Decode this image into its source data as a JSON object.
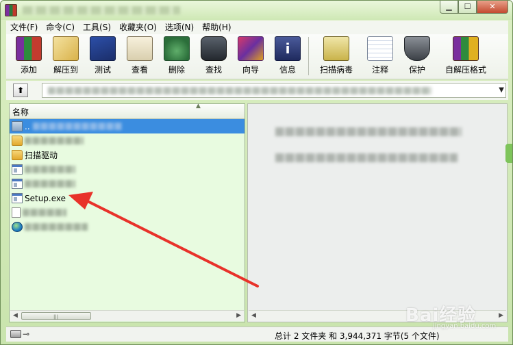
{
  "menubar": {
    "items": [
      "文件(F)",
      "命令(C)",
      "工具(S)",
      "收藏夹(O)",
      "选项(N)",
      "帮助(H)"
    ]
  },
  "toolbar": {
    "buttons": [
      {
        "label": "添加",
        "icon": "add-archive-icon"
      },
      {
        "label": "解压到",
        "icon": "extract-to-icon"
      },
      {
        "label": "测试",
        "icon": "test-icon"
      },
      {
        "label": "查看",
        "icon": "view-icon"
      },
      {
        "label": "删除",
        "icon": "delete-icon"
      },
      {
        "label": "查找",
        "icon": "find-icon"
      },
      {
        "label": "向导",
        "icon": "wizard-icon"
      },
      {
        "label": "信息",
        "icon": "info-icon"
      },
      {
        "label": "扫描病毒",
        "icon": "virus-scan-icon"
      },
      {
        "label": "注释",
        "icon": "comment-icon"
      },
      {
        "label": "保护",
        "icon": "protect-icon"
      },
      {
        "label": "自解压格式",
        "icon": "sfx-icon"
      }
    ]
  },
  "addressbar": {
    "up_label": "⬆"
  },
  "filelist": {
    "column_name": "名称",
    "items": [
      {
        "name": "..",
        "type": "folder-up",
        "selected": true
      },
      {
        "name": "",
        "type": "folder",
        "blurred": true
      },
      {
        "name": "扫描驱动",
        "type": "folder"
      },
      {
        "name": "",
        "type": "exe",
        "blurred": true
      },
      {
        "name": "",
        "type": "exe",
        "blurred": true
      },
      {
        "name": "Setup.exe",
        "type": "exe"
      },
      {
        "name": "",
        "type": "doc",
        "blurred": true
      },
      {
        "name": "",
        "type": "globe",
        "blurred": true
      }
    ]
  },
  "statusbar": {
    "text": "总计 2 文件夹 和 3,944,371 字节(5 个文件)"
  },
  "watermark": {
    "text": "Bai经验",
    "sub": "jingyan.baidu.com"
  },
  "colors": {
    "selection": "#3b8de0",
    "list_background": "#e8fbe0",
    "annotation_arrow": "#e8322a"
  }
}
